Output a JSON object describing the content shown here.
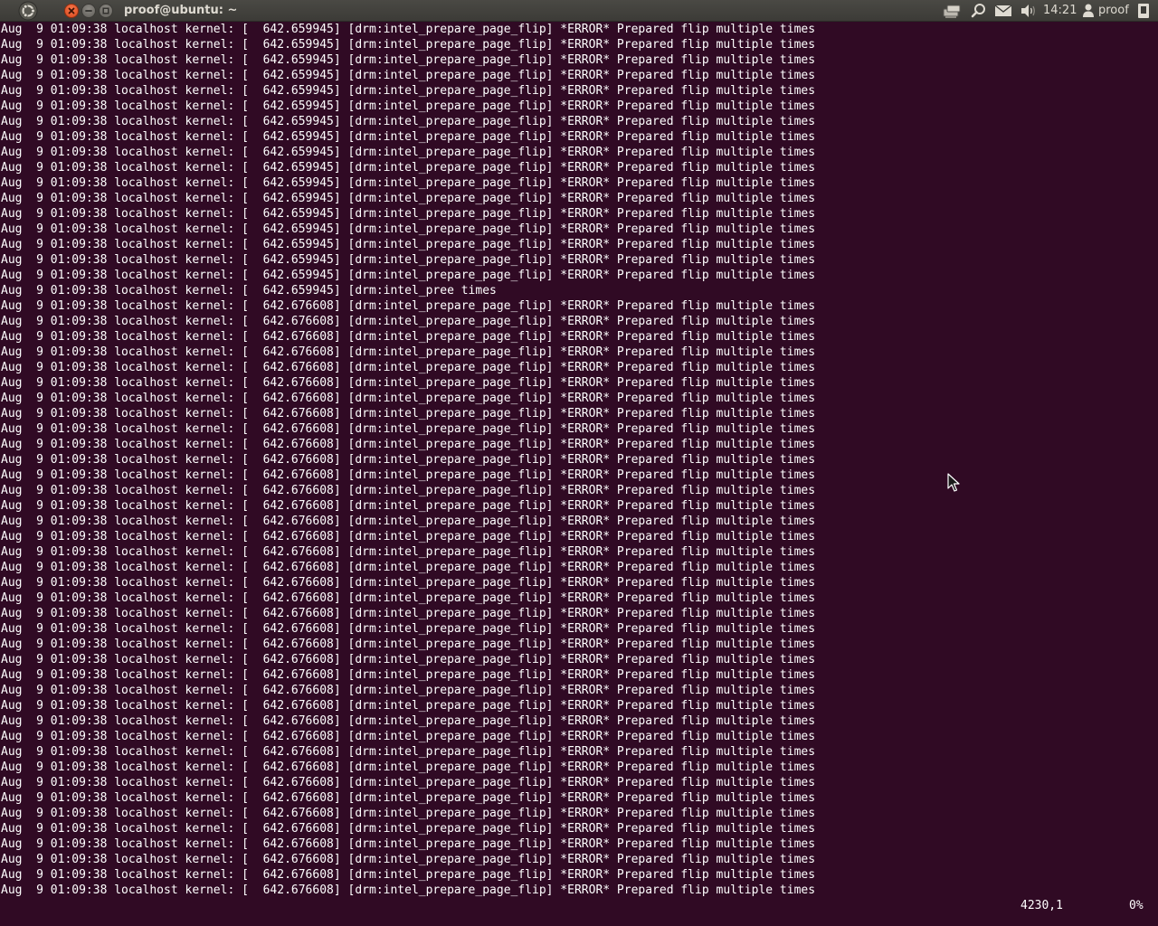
{
  "top_panel": {
    "window_title": "proof@ubuntu: ~",
    "clock": "14:21",
    "username": "proof"
  },
  "terminal": {
    "lines": [
      "Aug  9 01:09:38 localhost kernel: [  642.659945] [drm:intel_prepare_page_flip] *ERROR* Prepared flip multiple times",
      "Aug  9 01:09:38 localhost kernel: [  642.659945] [drm:intel_prepare_page_flip] *ERROR* Prepared flip multiple times",
      "Aug  9 01:09:38 localhost kernel: [  642.659945] [drm:intel_prepare_page_flip] *ERROR* Prepared flip multiple times",
      "Aug  9 01:09:38 localhost kernel: [  642.659945] [drm:intel_prepare_page_flip] *ERROR* Prepared flip multiple times",
      "Aug  9 01:09:38 localhost kernel: [  642.659945] [drm:intel_prepare_page_flip] *ERROR* Prepared flip multiple times",
      "Aug  9 01:09:38 localhost kernel: [  642.659945] [drm:intel_prepare_page_flip] *ERROR* Prepared flip multiple times",
      "Aug  9 01:09:38 localhost kernel: [  642.659945] [drm:intel_prepare_page_flip] *ERROR* Prepared flip multiple times",
      "Aug  9 01:09:38 localhost kernel: [  642.659945] [drm:intel_prepare_page_flip] *ERROR* Prepared flip multiple times",
      "Aug  9 01:09:38 localhost kernel: [  642.659945] [drm:intel_prepare_page_flip] *ERROR* Prepared flip multiple times",
      "Aug  9 01:09:38 localhost kernel: [  642.659945] [drm:intel_prepare_page_flip] *ERROR* Prepared flip multiple times",
      "Aug  9 01:09:38 localhost kernel: [  642.659945] [drm:intel_prepare_page_flip] *ERROR* Prepared flip multiple times",
      "Aug  9 01:09:38 localhost kernel: [  642.659945] [drm:intel_prepare_page_flip] *ERROR* Prepared flip multiple times",
      "Aug  9 01:09:38 localhost kernel: [  642.659945] [drm:intel_prepare_page_flip] *ERROR* Prepared flip multiple times",
      "Aug  9 01:09:38 localhost kernel: [  642.659945] [drm:intel_prepare_page_flip] *ERROR* Prepared flip multiple times",
      "Aug  9 01:09:38 localhost kernel: [  642.659945] [drm:intel_prepare_page_flip] *ERROR* Prepared flip multiple times",
      "Aug  9 01:09:38 localhost kernel: [  642.659945] [drm:intel_prepare_page_flip] *ERROR* Prepared flip multiple times",
      "Aug  9 01:09:38 localhost kernel: [  642.659945] [drm:intel_prepare_page_flip] *ERROR* Prepared flip multiple times",
      "Aug  9 01:09:38 localhost kernel: [  642.659945] [drm:intel_pree times",
      "Aug  9 01:09:38 localhost kernel: [  642.676608] [drm:intel_prepare_page_flip] *ERROR* Prepared flip multiple times",
      "Aug  9 01:09:38 localhost kernel: [  642.676608] [drm:intel_prepare_page_flip] *ERROR* Prepared flip multiple times",
      "Aug  9 01:09:38 localhost kernel: [  642.676608] [drm:intel_prepare_page_flip] *ERROR* Prepared flip multiple times",
      "Aug  9 01:09:38 localhost kernel: [  642.676608] [drm:intel_prepare_page_flip] *ERROR* Prepared flip multiple times",
      "Aug  9 01:09:38 localhost kernel: [  642.676608] [drm:intel_prepare_page_flip] *ERROR* Prepared flip multiple times",
      "Aug  9 01:09:38 localhost kernel: [  642.676608] [drm:intel_prepare_page_flip] *ERROR* Prepared flip multiple times",
      "Aug  9 01:09:38 localhost kernel: [  642.676608] [drm:intel_prepare_page_flip] *ERROR* Prepared flip multiple times",
      "Aug  9 01:09:38 localhost kernel: [  642.676608] [drm:intel_prepare_page_flip] *ERROR* Prepared flip multiple times",
      "Aug  9 01:09:38 localhost kernel: [  642.676608] [drm:intel_prepare_page_flip] *ERROR* Prepared flip multiple times",
      "Aug  9 01:09:38 localhost kernel: [  642.676608] [drm:intel_prepare_page_flip] *ERROR* Prepared flip multiple times",
      "Aug  9 01:09:38 localhost kernel: [  642.676608] [drm:intel_prepare_page_flip] *ERROR* Prepared flip multiple times",
      "Aug  9 01:09:38 localhost kernel: [  642.676608] [drm:intel_prepare_page_flip] *ERROR* Prepared flip multiple times",
      "Aug  9 01:09:38 localhost kernel: [  642.676608] [drm:intel_prepare_page_flip] *ERROR* Prepared flip multiple times",
      "Aug  9 01:09:38 localhost kernel: [  642.676608] [drm:intel_prepare_page_flip] *ERROR* Prepared flip multiple times",
      "Aug  9 01:09:38 localhost kernel: [  642.676608] [drm:intel_prepare_page_flip] *ERROR* Prepared flip multiple times",
      "Aug  9 01:09:38 localhost kernel: [  642.676608] [drm:intel_prepare_page_flip] *ERROR* Prepared flip multiple times",
      "Aug  9 01:09:38 localhost kernel: [  642.676608] [drm:intel_prepare_page_flip] *ERROR* Prepared flip multiple times",
      "Aug  9 01:09:38 localhost kernel: [  642.676608] [drm:intel_prepare_page_flip] *ERROR* Prepared flip multiple times",
      "Aug  9 01:09:38 localhost kernel: [  642.676608] [drm:intel_prepare_page_flip] *ERROR* Prepared flip multiple times",
      "Aug  9 01:09:38 localhost kernel: [  642.676608] [drm:intel_prepare_page_flip] *ERROR* Prepared flip multiple times",
      "Aug  9 01:09:38 localhost kernel: [  642.676608] [drm:intel_prepare_page_flip] *ERROR* Prepared flip multiple times",
      "Aug  9 01:09:38 localhost kernel: [  642.676608] [drm:intel_prepare_page_flip] *ERROR* Prepared flip multiple times",
      "Aug  9 01:09:38 localhost kernel: [  642.676608] [drm:intel_prepare_page_flip] *ERROR* Prepared flip multiple times",
      "Aug  9 01:09:38 localhost kernel: [  642.676608] [drm:intel_prepare_page_flip] *ERROR* Prepared flip multiple times",
      "Aug  9 01:09:38 localhost kernel: [  642.676608] [drm:intel_prepare_page_flip] *ERROR* Prepared flip multiple times",
      "Aug  9 01:09:38 localhost kernel: [  642.676608] [drm:intel_prepare_page_flip] *ERROR* Prepared flip multiple times",
      "Aug  9 01:09:38 localhost kernel: [  642.676608] [drm:intel_prepare_page_flip] *ERROR* Prepared flip multiple times",
      "Aug  9 01:09:38 localhost kernel: [  642.676608] [drm:intel_prepare_page_flip] *ERROR* Prepared flip multiple times",
      "Aug  9 01:09:38 localhost kernel: [  642.676608] [drm:intel_prepare_page_flip] *ERROR* Prepared flip multiple times",
      "Aug  9 01:09:38 localhost kernel: [  642.676608] [drm:intel_prepare_page_flip] *ERROR* Prepared flip multiple times",
      "Aug  9 01:09:38 localhost kernel: [  642.676608] [drm:intel_prepare_page_flip] *ERROR* Prepared flip multiple times",
      "Aug  9 01:09:38 localhost kernel: [  642.676608] [drm:intel_prepare_page_flip] *ERROR* Prepared flip multiple times",
      "Aug  9 01:09:38 localhost kernel: [  642.676608] [drm:intel_prepare_page_flip] *ERROR* Prepared flip multiple times",
      "Aug  9 01:09:38 localhost kernel: [  642.676608] [drm:intel_prepare_page_flip] *ERROR* Prepared flip multiple times",
      "Aug  9 01:09:38 localhost kernel: [  642.676608] [drm:intel_prepare_page_flip] *ERROR* Prepared flip multiple times",
      "Aug  9 01:09:38 localhost kernel: [  642.676608] [drm:intel_prepare_page_flip] *ERROR* Prepared flip multiple times",
      "Aug  9 01:09:38 localhost kernel: [  642.676608] [drm:intel_prepare_page_flip] *ERROR* Prepared flip multiple times",
      "Aug  9 01:09:38 localhost kernel: [  642.676608] [drm:intel_prepare_page_flip] *ERROR* Prepared flip multiple times",
      "Aug  9 01:09:38 localhost kernel: [  642.676608] [drm:intel_prepare_page_flip] *ERROR* Prepared flip multiple times"
    ],
    "status": {
      "position": "4230,1",
      "percent": "0%"
    }
  }
}
